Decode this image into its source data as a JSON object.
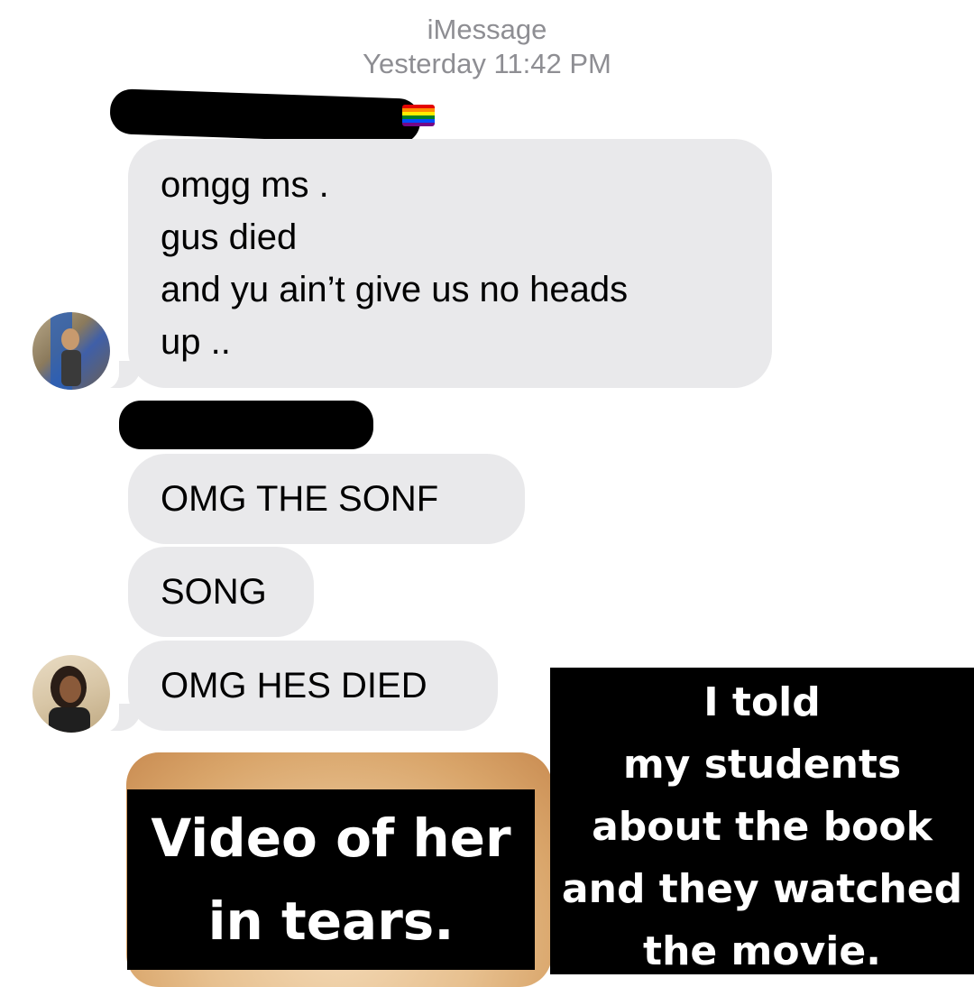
{
  "header": {
    "service": "iMessage",
    "timestamp": "Yesterday 11:42 PM"
  },
  "messages": [
    {
      "lines": [
        "omgg ms .",
        "gus died",
        "and yu ain’t give us no heads",
        "up .."
      ]
    },
    {
      "lines": [
        "OMG THE SONF"
      ]
    },
    {
      "lines": [
        "SONG"
      ]
    },
    {
      "lines": [
        "OMG HES DIED"
      ]
    }
  ],
  "captions": {
    "left": [
      "Video of her",
      "in tears."
    ],
    "right": [
      "I told",
      "my students",
      "about the book",
      "and they watched",
      "the movie."
    ]
  },
  "colors": {
    "bubble_gray": "#e9e9eb",
    "header_gray": "#8e8e93",
    "caption_bg": "#000000",
    "caption_text": "#ffffff"
  },
  "icons": {
    "flag": "rainbow-flag-icon",
    "redaction": "redaction-marker"
  }
}
